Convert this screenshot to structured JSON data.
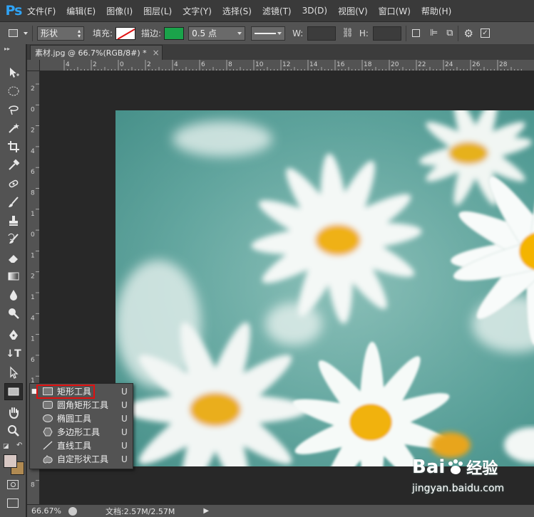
{
  "app": {
    "logo": "Ps"
  },
  "menubar": {
    "items": [
      "文件(F)",
      "编辑(E)",
      "图像(I)",
      "图层(L)",
      "文字(Y)",
      "选择(S)",
      "滤镜(T)",
      "3D(D)",
      "视图(V)",
      "窗口(W)",
      "帮助(H)"
    ]
  },
  "options": {
    "mode": "形状",
    "fill_label": "填充:",
    "stroke_label": "描边:",
    "stroke_width": "0.5 点",
    "w_label": "W:",
    "h_label": "H:",
    "stroke_color": "#1aa34a",
    "fill_color": "#ffffff"
  },
  "document": {
    "tab_title": "素材.jpg @ 66.7%(RGB/8#) *",
    "tab_close": "×",
    "zoom": "66.67%",
    "doc_size": "文档:2.57M/2.57M"
  },
  "rulers": {
    "top": [
      "4",
      "2",
      "0",
      "2",
      "4",
      "6",
      "8",
      "10",
      "12",
      "14",
      "16",
      "18",
      "20",
      "22",
      "24",
      "26",
      "28"
    ],
    "left": [
      "2",
      "0",
      "2",
      "4",
      "6",
      "8",
      "1",
      "0",
      "1",
      "2",
      "1",
      "4",
      "1",
      "6",
      "1",
      "8",
      "2",
      "0",
      "6",
      "8"
    ]
  },
  "flyout": {
    "items": [
      {
        "label": "矩形工具",
        "key": "U",
        "icon": "rect-icon",
        "selected": true
      },
      {
        "label": "圆角矩形工具",
        "key": "U",
        "icon": "rounded-rect-icon",
        "selected": false
      },
      {
        "label": "椭圆工具",
        "key": "U",
        "icon": "ellipse-icon",
        "selected": false
      },
      {
        "label": "多边形工具",
        "key": "U",
        "icon": "polygon-icon",
        "selected": false
      },
      {
        "label": "直线工具",
        "key": "U",
        "icon": "line-icon",
        "selected": false
      },
      {
        "label": "自定形状工具",
        "key": "U",
        "icon": "custom-shape-icon",
        "selected": false
      }
    ]
  },
  "watermark": {
    "brand": "Bai",
    "brand_suffix": "经验",
    "url": "jingyan.baidu.com"
  },
  "colors": {
    "foreground": "#d8c8c4",
    "background": "#b08a52",
    "highlight": "#e01010"
  }
}
